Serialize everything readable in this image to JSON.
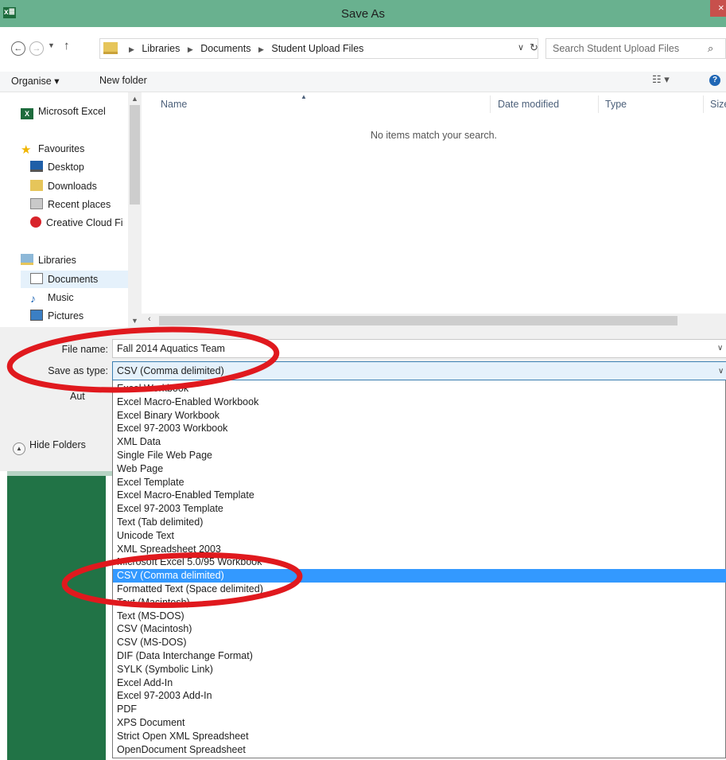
{
  "window": {
    "title": "Save As",
    "app_icon_label": "x≣",
    "close_glyph": "×"
  },
  "address_bar": {
    "breadcrumbs": [
      "Libraries",
      "Documents",
      "Student Upload Files"
    ],
    "search_placeholder": "Search Student Upload Files"
  },
  "toolbar": {
    "organise_label": "Organise ▾",
    "new_folder_label": "New folder",
    "views_glyph": "☷ ▾",
    "help_glyph": "?"
  },
  "navigation": {
    "items": [
      {
        "label": "Microsoft Excel",
        "icon": "excel-icon"
      },
      {
        "label": "Favourites",
        "icon": "star-icon"
      },
      {
        "label": "Desktop",
        "icon": "desktop-icon"
      },
      {
        "label": "Downloads",
        "icon": "downloads-folder-icon"
      },
      {
        "label": "Recent places",
        "icon": "recent-places-icon"
      },
      {
        "label": "Creative Cloud Fi",
        "icon": "creative-cloud-icon"
      },
      {
        "label": "Libraries",
        "icon": "libraries-icon"
      },
      {
        "label": "Documents",
        "icon": "documents-icon"
      },
      {
        "label": "Music",
        "icon": "music-icon"
      },
      {
        "label": "Pictures",
        "icon": "pictures-icon"
      }
    ]
  },
  "file_list": {
    "columns": [
      "Name",
      "Date modified",
      "Type",
      "Size"
    ],
    "empty_message": "No items match your search."
  },
  "form": {
    "file_name_label": "File name:",
    "file_name_value": "Fall 2014 Aquatics Team",
    "save_type_label": "Save as type:",
    "save_type_value": "CSV (Comma delimited)",
    "authors_partial": "Aut",
    "hide_folders_label": "Hide Folders"
  },
  "save_type_options": [
    "Excel Workbook",
    "Excel Macro-Enabled Workbook",
    "Excel Binary Workbook",
    "Excel 97-2003 Workbook",
    "XML Data",
    "Single File Web Page",
    "Web Page",
    "Excel Template",
    "Excel Macro-Enabled Template",
    "Excel 97-2003 Template",
    "Text (Tab delimited)",
    "Unicode Text",
    "XML Spreadsheet 2003",
    "Microsoft Excel 5.0/95 Workbook",
    "CSV (Comma delimited)",
    "Formatted Text (Space delimited)",
    "Text (Macintosh)",
    "Text (MS-DOS)",
    "CSV (Macintosh)",
    "CSV (MS-DOS)",
    "DIF (Data Interchange Format)",
    "SYLK (Symbolic Link)",
    "Excel Add-In",
    "Excel 97-2003 Add-In",
    "PDF",
    "XPS Document",
    "Strict Open XML Spreadsheet",
    "OpenDocument Spreadsheet"
  ],
  "selected_option_index": 14,
  "colors": {
    "titlebar": "#69b18f",
    "selection": "#3399ff",
    "annotation": "#e0191e",
    "excel_green": "#217346"
  }
}
